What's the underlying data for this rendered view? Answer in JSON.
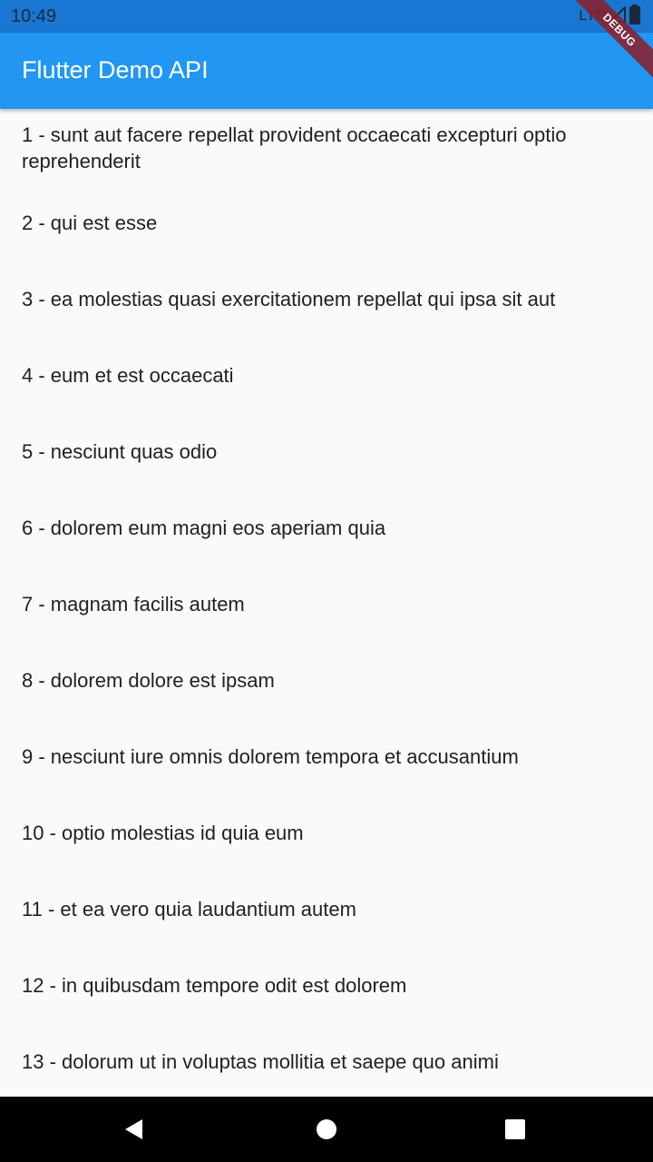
{
  "status_bar": {
    "time": "10:49",
    "network": "LTE"
  },
  "app_bar": {
    "title": "Flutter Demo API"
  },
  "debug_banner": "DEBUG",
  "posts": [
    "1 - sunt aut facere repellat provident occaecati excepturi optio reprehenderit",
    "2 - qui est esse",
    "3 - ea molestias quasi exercitationem repellat qui ipsa sit aut",
    "4 - eum et est occaecati",
    "5 - nesciunt quas odio",
    "6 - dolorem eum magni eos aperiam quia",
    "7 - magnam facilis autem",
    "8 - dolorem dolore est ipsam",
    "9 - nesciunt iure omnis dolorem tempora et accusantium",
    "10 - optio molestias id quia eum",
    "11 - et ea vero quia laudantium autem",
    "12 - in quibusdam tempore odit est dolorem",
    "13 - dolorum ut in voluptas mollitia et saepe quo animi"
  ],
  "nav_bar": {
    "back_icon": "back-triangle-icon",
    "home_icon": "home-circle-icon",
    "recents_icon": "recents-square-icon"
  },
  "colors": {
    "app_bar": "#2196f3",
    "status_bar": "#1976d2",
    "background": "#fafafa",
    "text": "#212121"
  }
}
